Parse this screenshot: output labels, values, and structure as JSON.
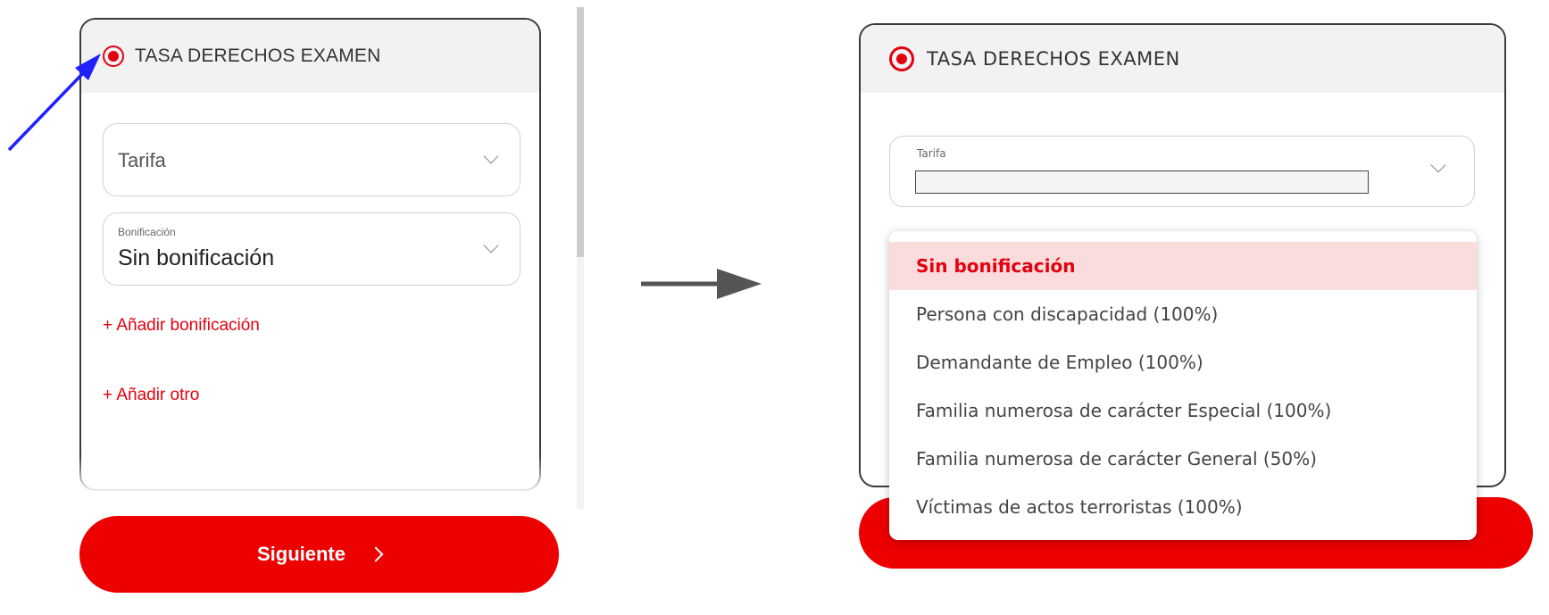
{
  "left_panel": {
    "section_title": "TASA DERECHOS EXAMEN",
    "tarifa_label": "Tarifa",
    "bonificacion_label": "Bonificación",
    "bonificacion_value": "Sin bonificación",
    "add_bonus_link": "+ Añadir bonificación",
    "add_other_link": "+ Añadir otro",
    "next_button": "Siguiente"
  },
  "right_panel": {
    "section_title": "TASA DERECHOS EXAMEN",
    "tarifa_label": "Tarifa",
    "dropdown_options": [
      "Sin bonificación",
      "Persona con discapacidad (100%)",
      "Demandante de Empleo (100%)",
      "Familia numerosa de carácter Especial (100%)",
      "Familia numerosa de carácter General (50%)",
      "Víctimas de actos terroristas (100%)"
    ],
    "selected_option": "Sin bonificación"
  },
  "colors": {
    "accent_red": "#e3000f",
    "button_red": "#ec0000",
    "annotation_arrow_blue": "#1f1fff",
    "transition_arrow_gray": "#555555"
  }
}
